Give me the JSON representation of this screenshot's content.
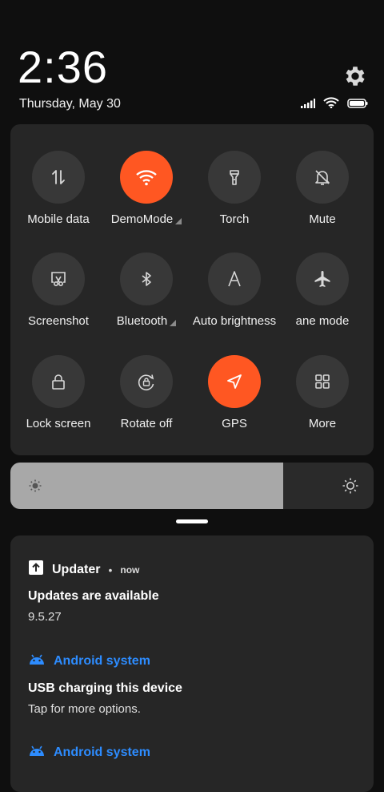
{
  "status": {
    "time": "2:36",
    "date": "Thursday, May 30"
  },
  "quick_settings": [
    {
      "label": "Mobile data",
      "icon": "mobile-data-icon",
      "on": false,
      "expand": false
    },
    {
      "label": "DemoMode",
      "icon": "wifi-icon",
      "on": true,
      "expand": true
    },
    {
      "label": "Torch",
      "icon": "torch-icon",
      "on": false,
      "expand": false
    },
    {
      "label": "Mute",
      "icon": "mute-icon",
      "on": false,
      "expand": false
    },
    {
      "label": "Screenshot",
      "icon": "screenshot-icon",
      "on": false,
      "expand": false
    },
    {
      "label": "Bluetooth",
      "icon": "bluetooth-icon",
      "on": false,
      "expand": true
    },
    {
      "label": "Auto brightness",
      "icon": "auto-brightness-icon",
      "on": false,
      "expand": false
    },
    {
      "label": "ane mode",
      "icon": "airplane-icon",
      "on": false,
      "expand": false
    },
    {
      "label": "Lock screen",
      "icon": "lock-icon",
      "on": false,
      "expand": false
    },
    {
      "label": "Rotate off",
      "icon": "rotate-icon",
      "on": false,
      "expand": false
    },
    {
      "label": "GPS",
      "icon": "gps-icon",
      "on": true,
      "expand": false
    },
    {
      "label": "More",
      "icon": "more-icon",
      "on": false,
      "expand": false
    }
  ],
  "brightness": {
    "level": 0.75
  },
  "notifications": {
    "updater": {
      "app": "Updater",
      "dot": "•",
      "time": "now",
      "title": "Updates are available",
      "text": "9.5.27"
    },
    "android1": {
      "app": "Android system",
      "title": "USB charging this device",
      "text": "Tap for more options."
    },
    "android2": {
      "app": "Android system"
    }
  },
  "colors": {
    "accent": "#ff5722",
    "tile": "#383838",
    "panel": "#262626",
    "link": "#2d8cff"
  }
}
